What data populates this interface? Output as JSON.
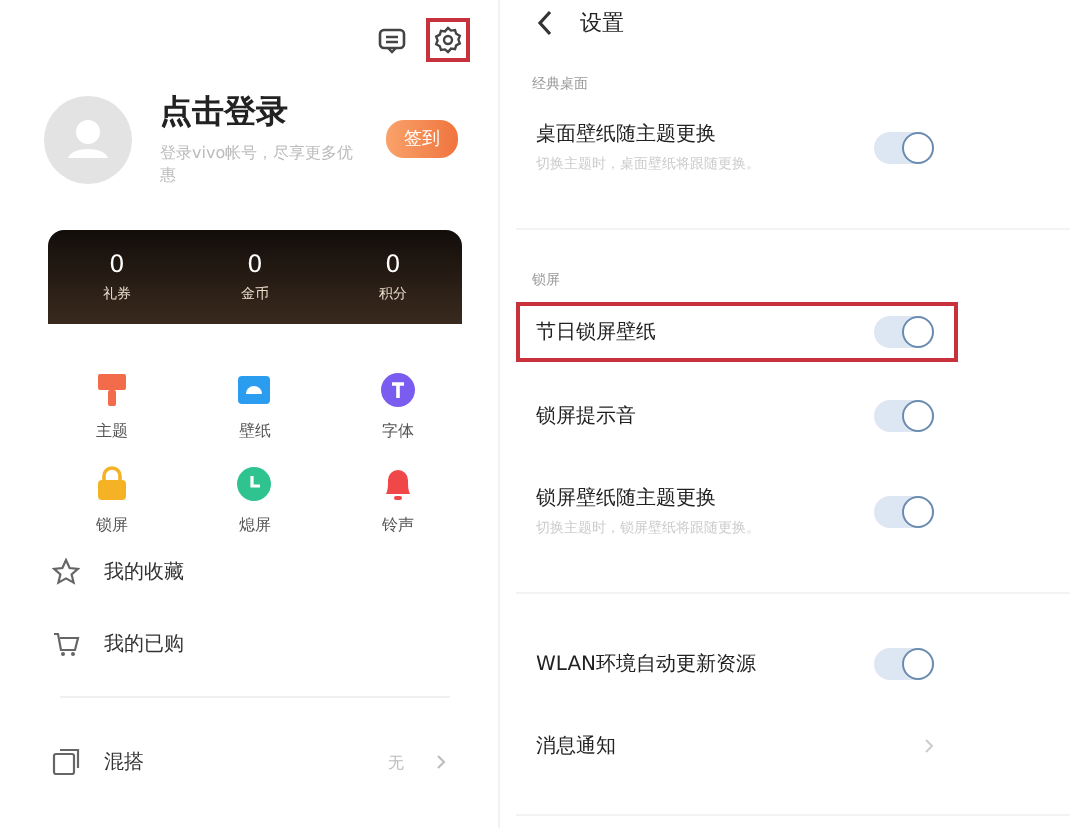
{
  "left": {
    "topbar": {
      "message_icon": true,
      "settings_highlighted": true
    },
    "profile": {
      "title": "点击登录",
      "subtitle": "登录vivo帐号，尽享更多优惠",
      "button": "签到"
    },
    "stats": [
      {
        "value": "0",
        "label": "礼券"
      },
      {
        "value": "0",
        "label": "金币"
      },
      {
        "value": "0",
        "label": "积分"
      }
    ],
    "grid": [
      {
        "kind": "brush",
        "label": "主题",
        "color": "#f26b4a"
      },
      {
        "kind": "wallpaper",
        "label": "壁纸",
        "color": "#2b9df0"
      },
      {
        "kind": "font",
        "label": "字体",
        "color": "#7a5cf0"
      },
      {
        "kind": "lock",
        "label": "锁屏",
        "color": "#f5b225"
      },
      {
        "kind": "clock",
        "label": "熄屏",
        "color": "#2fc48f"
      },
      {
        "kind": "bell",
        "label": "铃声",
        "color": "#f04848"
      }
    ],
    "menu": [
      {
        "kind": "star",
        "label": "我的收藏"
      },
      {
        "kind": "cart",
        "label": "我的已购"
      }
    ],
    "mix": {
      "label": "混搭",
      "value": "无"
    }
  },
  "right": {
    "title": "设置",
    "sections": [
      {
        "label": "经典桌面",
        "rows": [
          {
            "kind": "toggle",
            "title": "桌面壁纸随主题更换",
            "subtitle": "切换主题时，桌面壁纸将跟随更换。",
            "on": true,
            "highlighted": false
          }
        ]
      },
      {
        "label": "锁屏",
        "rows": [
          {
            "kind": "toggle",
            "title": "节日锁屏壁纸",
            "on": true,
            "highlighted": true
          },
          {
            "kind": "toggle",
            "title": "锁屏提示音",
            "on": true,
            "highlighted": false
          },
          {
            "kind": "toggle",
            "title": "锁屏壁纸随主题更换",
            "subtitle": "切换主题时，锁屏壁纸将跟随更换。",
            "on": true,
            "highlighted": false
          }
        ]
      },
      {
        "rows": [
          {
            "kind": "toggle",
            "title": "WLAN环境自动更新资源",
            "on": true,
            "highlighted": false
          },
          {
            "kind": "link",
            "title": "消息通知",
            "highlighted": false
          }
        ]
      }
    ]
  }
}
